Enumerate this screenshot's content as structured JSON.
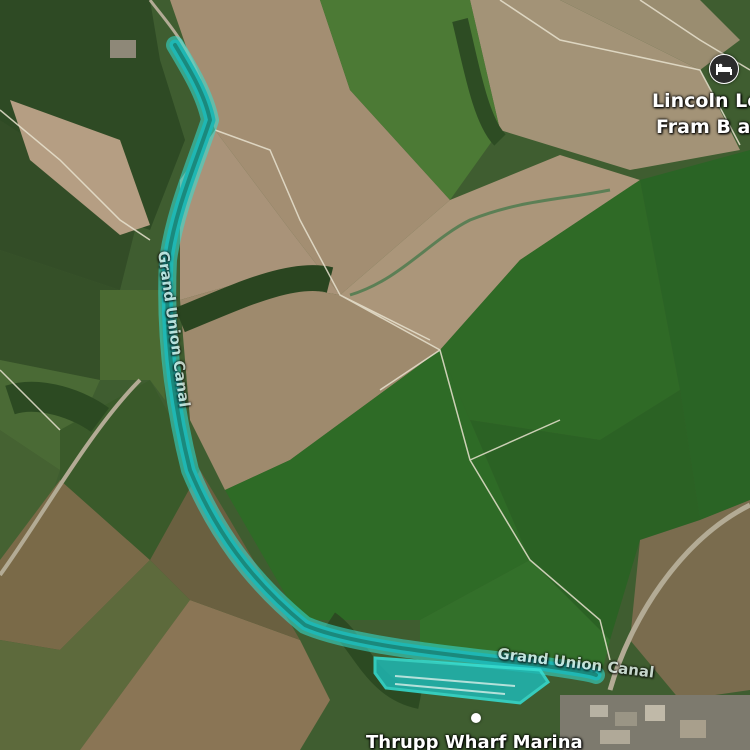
{
  "map": {
    "type": "satellite",
    "colors": {
      "waterway_fill": "#1fb7b3",
      "waterway_stroke": "#35e0d6",
      "boundary_line": "#e8e2cf",
      "label_text": "#ffffff"
    }
  },
  "labels": {
    "canal_vertical": "Grand Union Canal",
    "canal_horizontal": "Grand Union Canal",
    "poi_line1": "Lincoln Lo",
    "poi_line2": "Fram B a",
    "marina": "Thrupp Wharf Marina"
  },
  "icons": {
    "poi": "bed-icon",
    "marina": "point-marker-icon"
  }
}
